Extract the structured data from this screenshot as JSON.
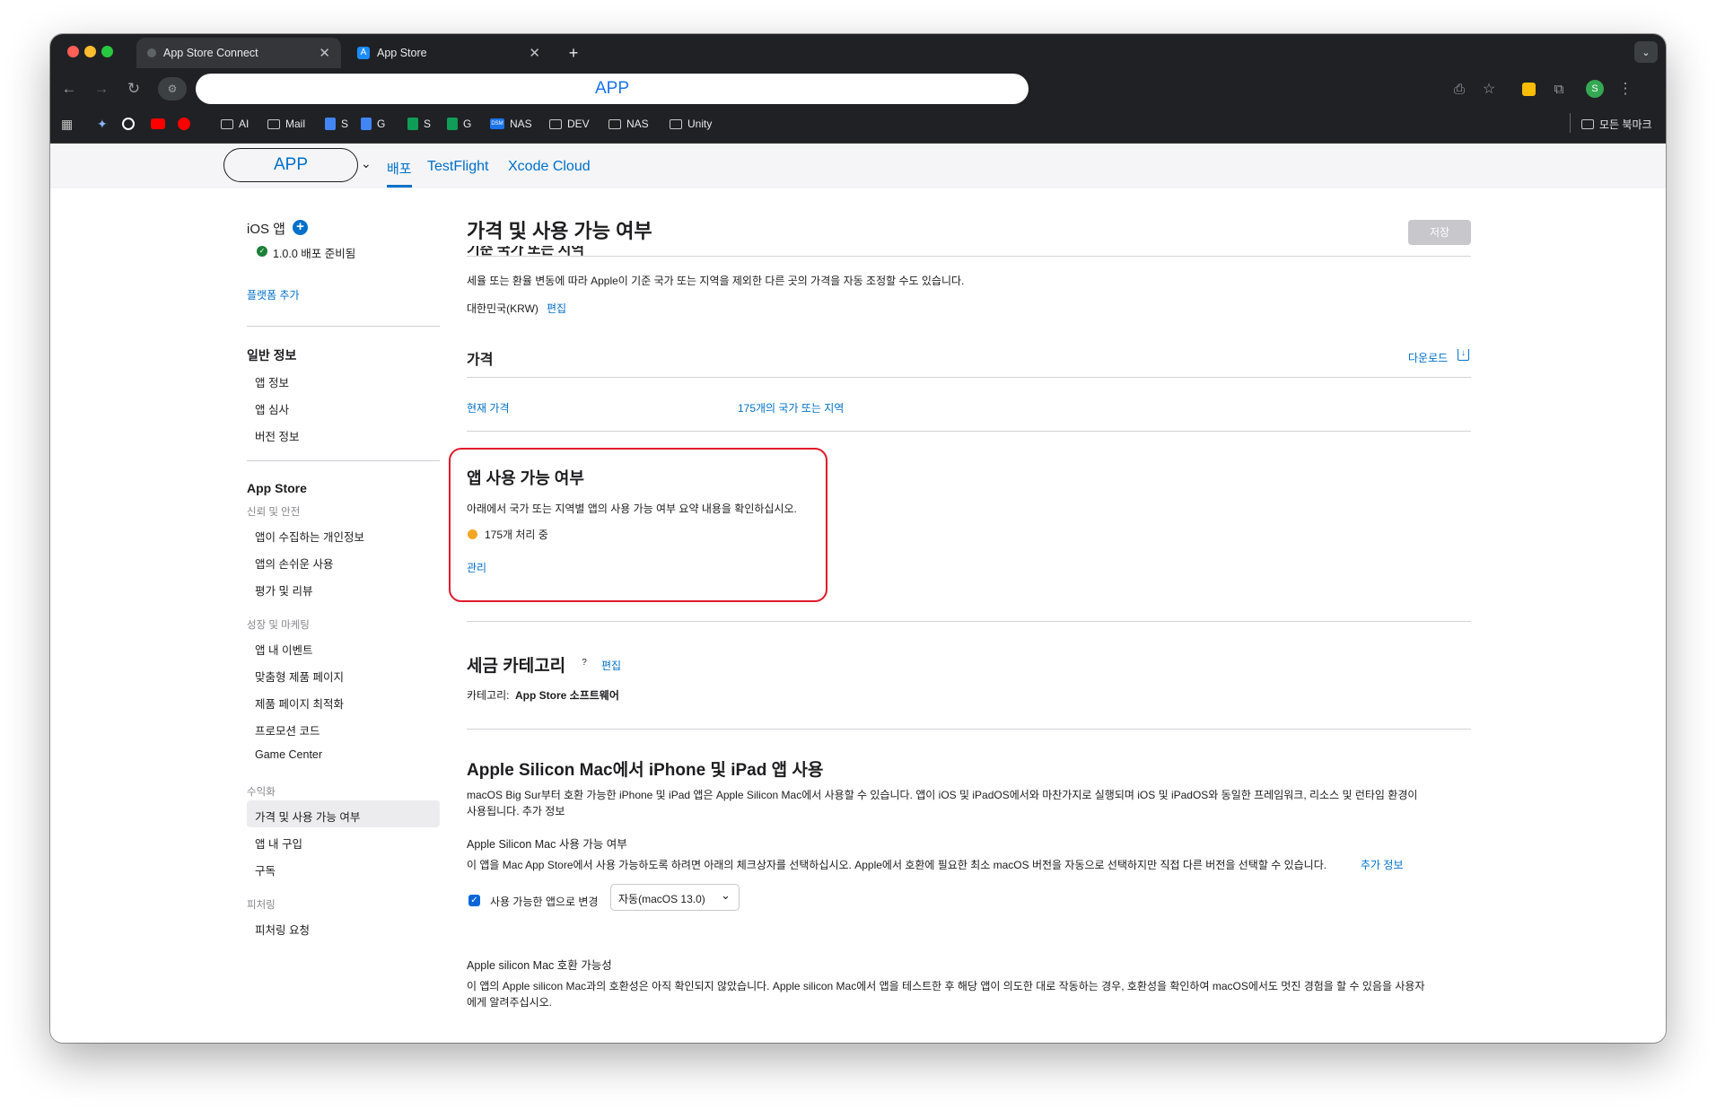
{
  "browser": {
    "tabs": [
      {
        "title": "App Store Connect"
      },
      {
        "title": "App Store"
      }
    ],
    "address": "APP",
    "bookmarks": [
      "AI",
      "Mail",
      "S",
      "G",
      "S",
      "G",
      "NAS",
      "DEV",
      "NAS",
      "Unity"
    ],
    "all_bookmarks": "모든 북마크"
  },
  "header": {
    "app_name": "APP",
    "tabs": [
      "배포",
      "TestFlight",
      "Xcode Cloud"
    ]
  },
  "sidebar": {
    "platform": "iOS 앱",
    "version": "1.0.0 배포 준비됨",
    "add_platform": "플랫폼 추가",
    "general_title": "일반 정보",
    "general_items": [
      "앱 정보",
      "앱 심사",
      "버전 정보"
    ],
    "appstore_title": "App Store",
    "trust_label": "신뢰 및 안전",
    "trust_items": [
      "앱이 수집하는 개인정보",
      "앱의 손쉬운 사용",
      "평가 및 리뷰"
    ],
    "growth_label": "성장 및 마케팅",
    "growth_items": [
      "앱 내 이벤트",
      "맞춤형 제품 페이지",
      "제품 페이지 최적화",
      "프로모션 코드",
      "Game Center"
    ],
    "monetize_label": "수익화",
    "monetize_items": [
      "가격 및 사용 가능 여부",
      "앱 내 구입",
      "구독"
    ],
    "featuring_label": "피처링",
    "featuring_items": [
      "피처링 요청"
    ]
  },
  "main": {
    "title": "가격 및 사용 가능 여부",
    "save": "저장",
    "cut_heading": "기준 국가 또는 지역",
    "base_desc": "세율 또는 환율 변동에 따라 Apple이 기준 국가 또는 지역을 제외한 다른 곳의 가격을 자동 조정할 수도 있습니다.",
    "base_value": "대한민국(KRW)",
    "edit": "편집",
    "price_title": "가격",
    "download": "다운로드",
    "current_price": "현재 가격",
    "countries": "175개의 국가 또는 지역",
    "avail_title": "앱 사용 가능 여부",
    "avail_desc": "아래에서 국가 또는 지역별 앱의 사용 가능 여부 요약 내용을 확인하십시오.",
    "avail_status": "175개 처리 중",
    "manage": "관리",
    "tax_title": "세금 카테고리",
    "tax_help": "?",
    "tax_label": "카테고리:",
    "tax_value": "App Store 소프트웨어",
    "mac_title": "Apple Silicon Mac에서 iPhone 및 iPad 앱 사용",
    "mac_desc1": "macOS Big Sur부터 호환 가능한 iPhone 및 iPad 앱은 Apple Silicon Mac에서 사용할 수 있습니다. 앱이 iOS 및 iPadOS에서와 마찬가지로 실행되며 iOS 및 iPadOS와 동일한 프레임워크, 리소스 및 런타임 환경이",
    "mac_desc2": "사용됩니다. 추가 정보",
    "mac_avail_title": "Apple Silicon Mac 사용 가능 여부",
    "mac_avail_desc": "이 앱을 Mac App Store에서 사용 가능하도록 하려면 아래의 체크상자를 선택하십시오. Apple에서 호환에 필요한 최소 macOS 버전을 자동으로 선택하지만 직접 다른 버전을 선택할 수 있습니다.",
    "more_info": "추가 정보",
    "checkbox_label": "사용 가능한 앱으로 변경",
    "version_select": "자동(macOS 13.0)",
    "compat_title": "Apple silicon Mac 호환 가능성",
    "compat_desc1": "이 앱의 Apple silicon Mac과의 호환성은 아직 확인되지 않았습니다. Apple silicon Mac에서 앱을 테스트한 후 해당 앱이 의도한 대로 작동하는 경우, 호환성을 확인하여 macOS에서도 멋진 경험을 할 수 있음을 사용자",
    "compat_desc2": "에게 알려주십시오."
  }
}
